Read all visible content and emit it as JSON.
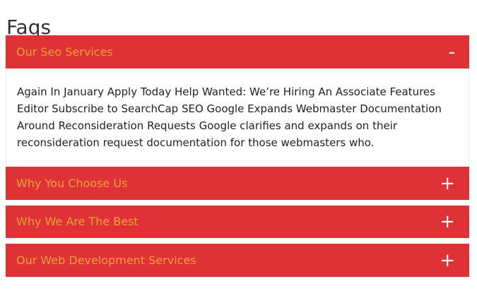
{
  "page": {
    "title": "Faqs"
  },
  "accordion": {
    "items": [
      {
        "label": "Our Seo Services",
        "toggle": "-",
        "expanded": true,
        "body": "Again In January Apply Today Help Wanted: We’re Hiring An Associate Features Editor Subscribe to SearchCap SEO Google Expands Webmaster Documentation Around Reconsideration Requests Google clarifies and expands on their reconsideration request documentation for those webmasters who."
      },
      {
        "label": "Why You Choose Us",
        "toggle": "+",
        "expanded": false
      },
      {
        "label": "Why We Are The Best",
        "toggle": "+",
        "expanded": false
      },
      {
        "label": "Our Web Development Services",
        "toggle": "+",
        "expanded": false
      }
    ]
  },
  "colors": {
    "header_background": "#df3236",
    "header_text": "#f0a038",
    "toggle_icon": "#ffffff",
    "body_text": "#222222",
    "title_text": "#333333"
  },
  "icons": {
    "expanded": "minus-icon",
    "collapsed": "plus-icon"
  }
}
